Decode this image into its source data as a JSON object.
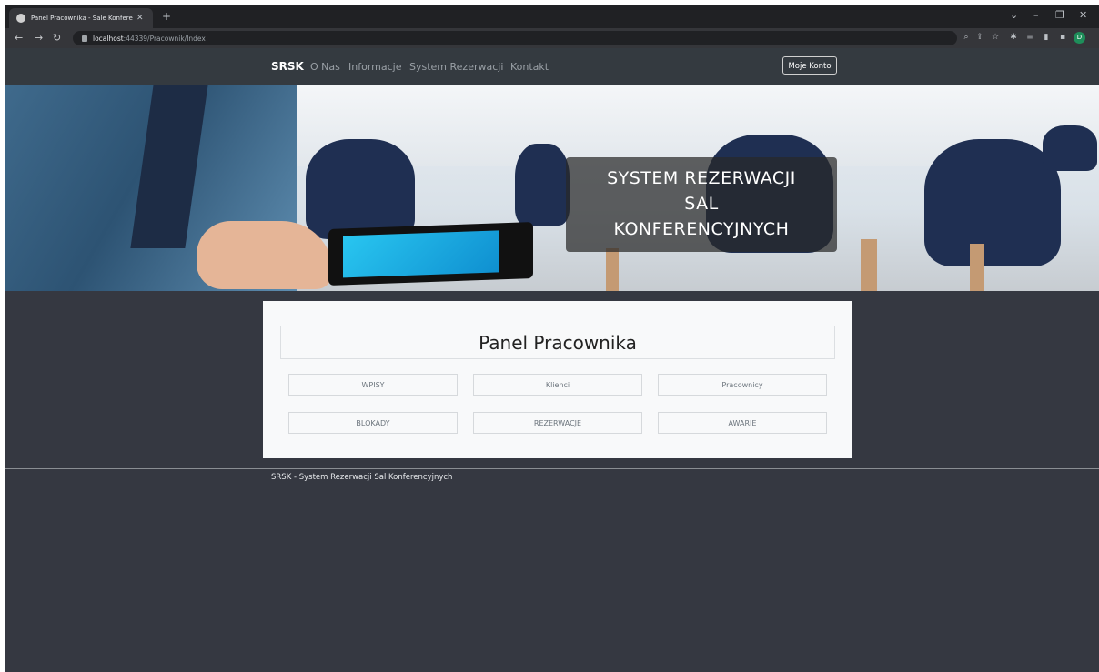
{
  "browser": {
    "tab_title": "Panel Pracownika - Sale Konfere",
    "tab_close": "✕",
    "new_tab": "+",
    "url_host": "localhost",
    "url_path": ":44339/Pracownik/Index",
    "profile_initial": "D",
    "window_controls": [
      "⌄",
      "–",
      "❐",
      "✕"
    ]
  },
  "nav": {
    "brand": "SRSK",
    "links": [
      "O Nas",
      "Informacje",
      "System Rezerwacji",
      "Kontakt"
    ],
    "account": "Moje Konto"
  },
  "hero": {
    "lines": [
      "SYSTEM REZERWACJI",
      "SAL",
      "KONFERENCYJNYCH"
    ]
  },
  "panel": {
    "title": "Panel Pracownika",
    "buttons": [
      "WPISY",
      "Klienci",
      "Pracownicy",
      "BLOKADY",
      "REZERWACJE",
      "AWARIE"
    ]
  },
  "footer": {
    "text": "SRSK - System Rezerwacji Sal Konferencyjnych"
  }
}
